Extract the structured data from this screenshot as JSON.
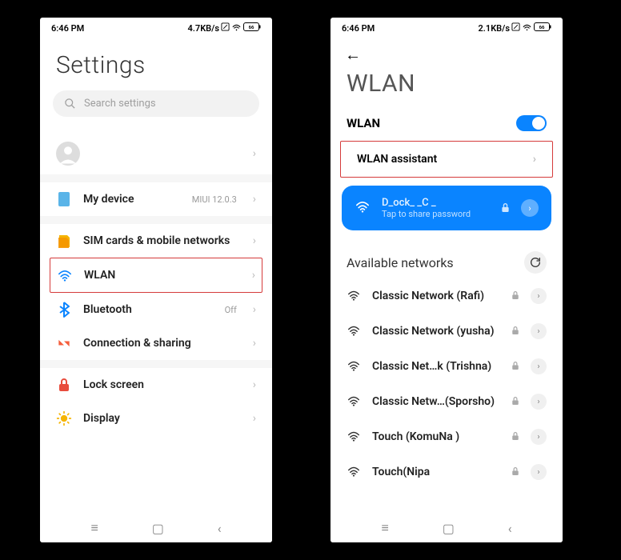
{
  "left": {
    "status": {
      "time": "6:46 PM",
      "speed": "4.7KB/s",
      "battery": "66"
    },
    "title": "Settings",
    "search_placeholder": "Search settings",
    "rows": {
      "account": {
        "label": ""
      },
      "mydevice": {
        "label": "My device",
        "sub": "MIUI 12.0.3"
      },
      "sim": {
        "label": "SIM cards & mobile networks"
      },
      "wlan": {
        "label": "WLAN"
      },
      "bluetooth": {
        "label": "Bluetooth",
        "sub": "Off"
      },
      "connection": {
        "label": "Connection & sharing"
      },
      "lock": {
        "label": "Lock screen"
      },
      "display": {
        "label": "Display"
      }
    }
  },
  "right": {
    "status": {
      "time": "6:46 PM",
      "speed": "2.1KB/s",
      "battery": "66"
    },
    "title": "WLAN",
    "wlan_label": "WLAN",
    "assistant_label": "WLAN assistant",
    "connected": {
      "name": "D_ock_ _C _",
      "sub": "Tap to share password"
    },
    "available_label": "Available networks",
    "networks": [
      "Classic Network (Rafi)",
      "Classic Network (yusha)",
      "Classic Net…k (Trishna)",
      "Classic Netw…(Sporsho)",
      "Touch (KomuNa )",
      "Touch(Nipa"
    ]
  }
}
